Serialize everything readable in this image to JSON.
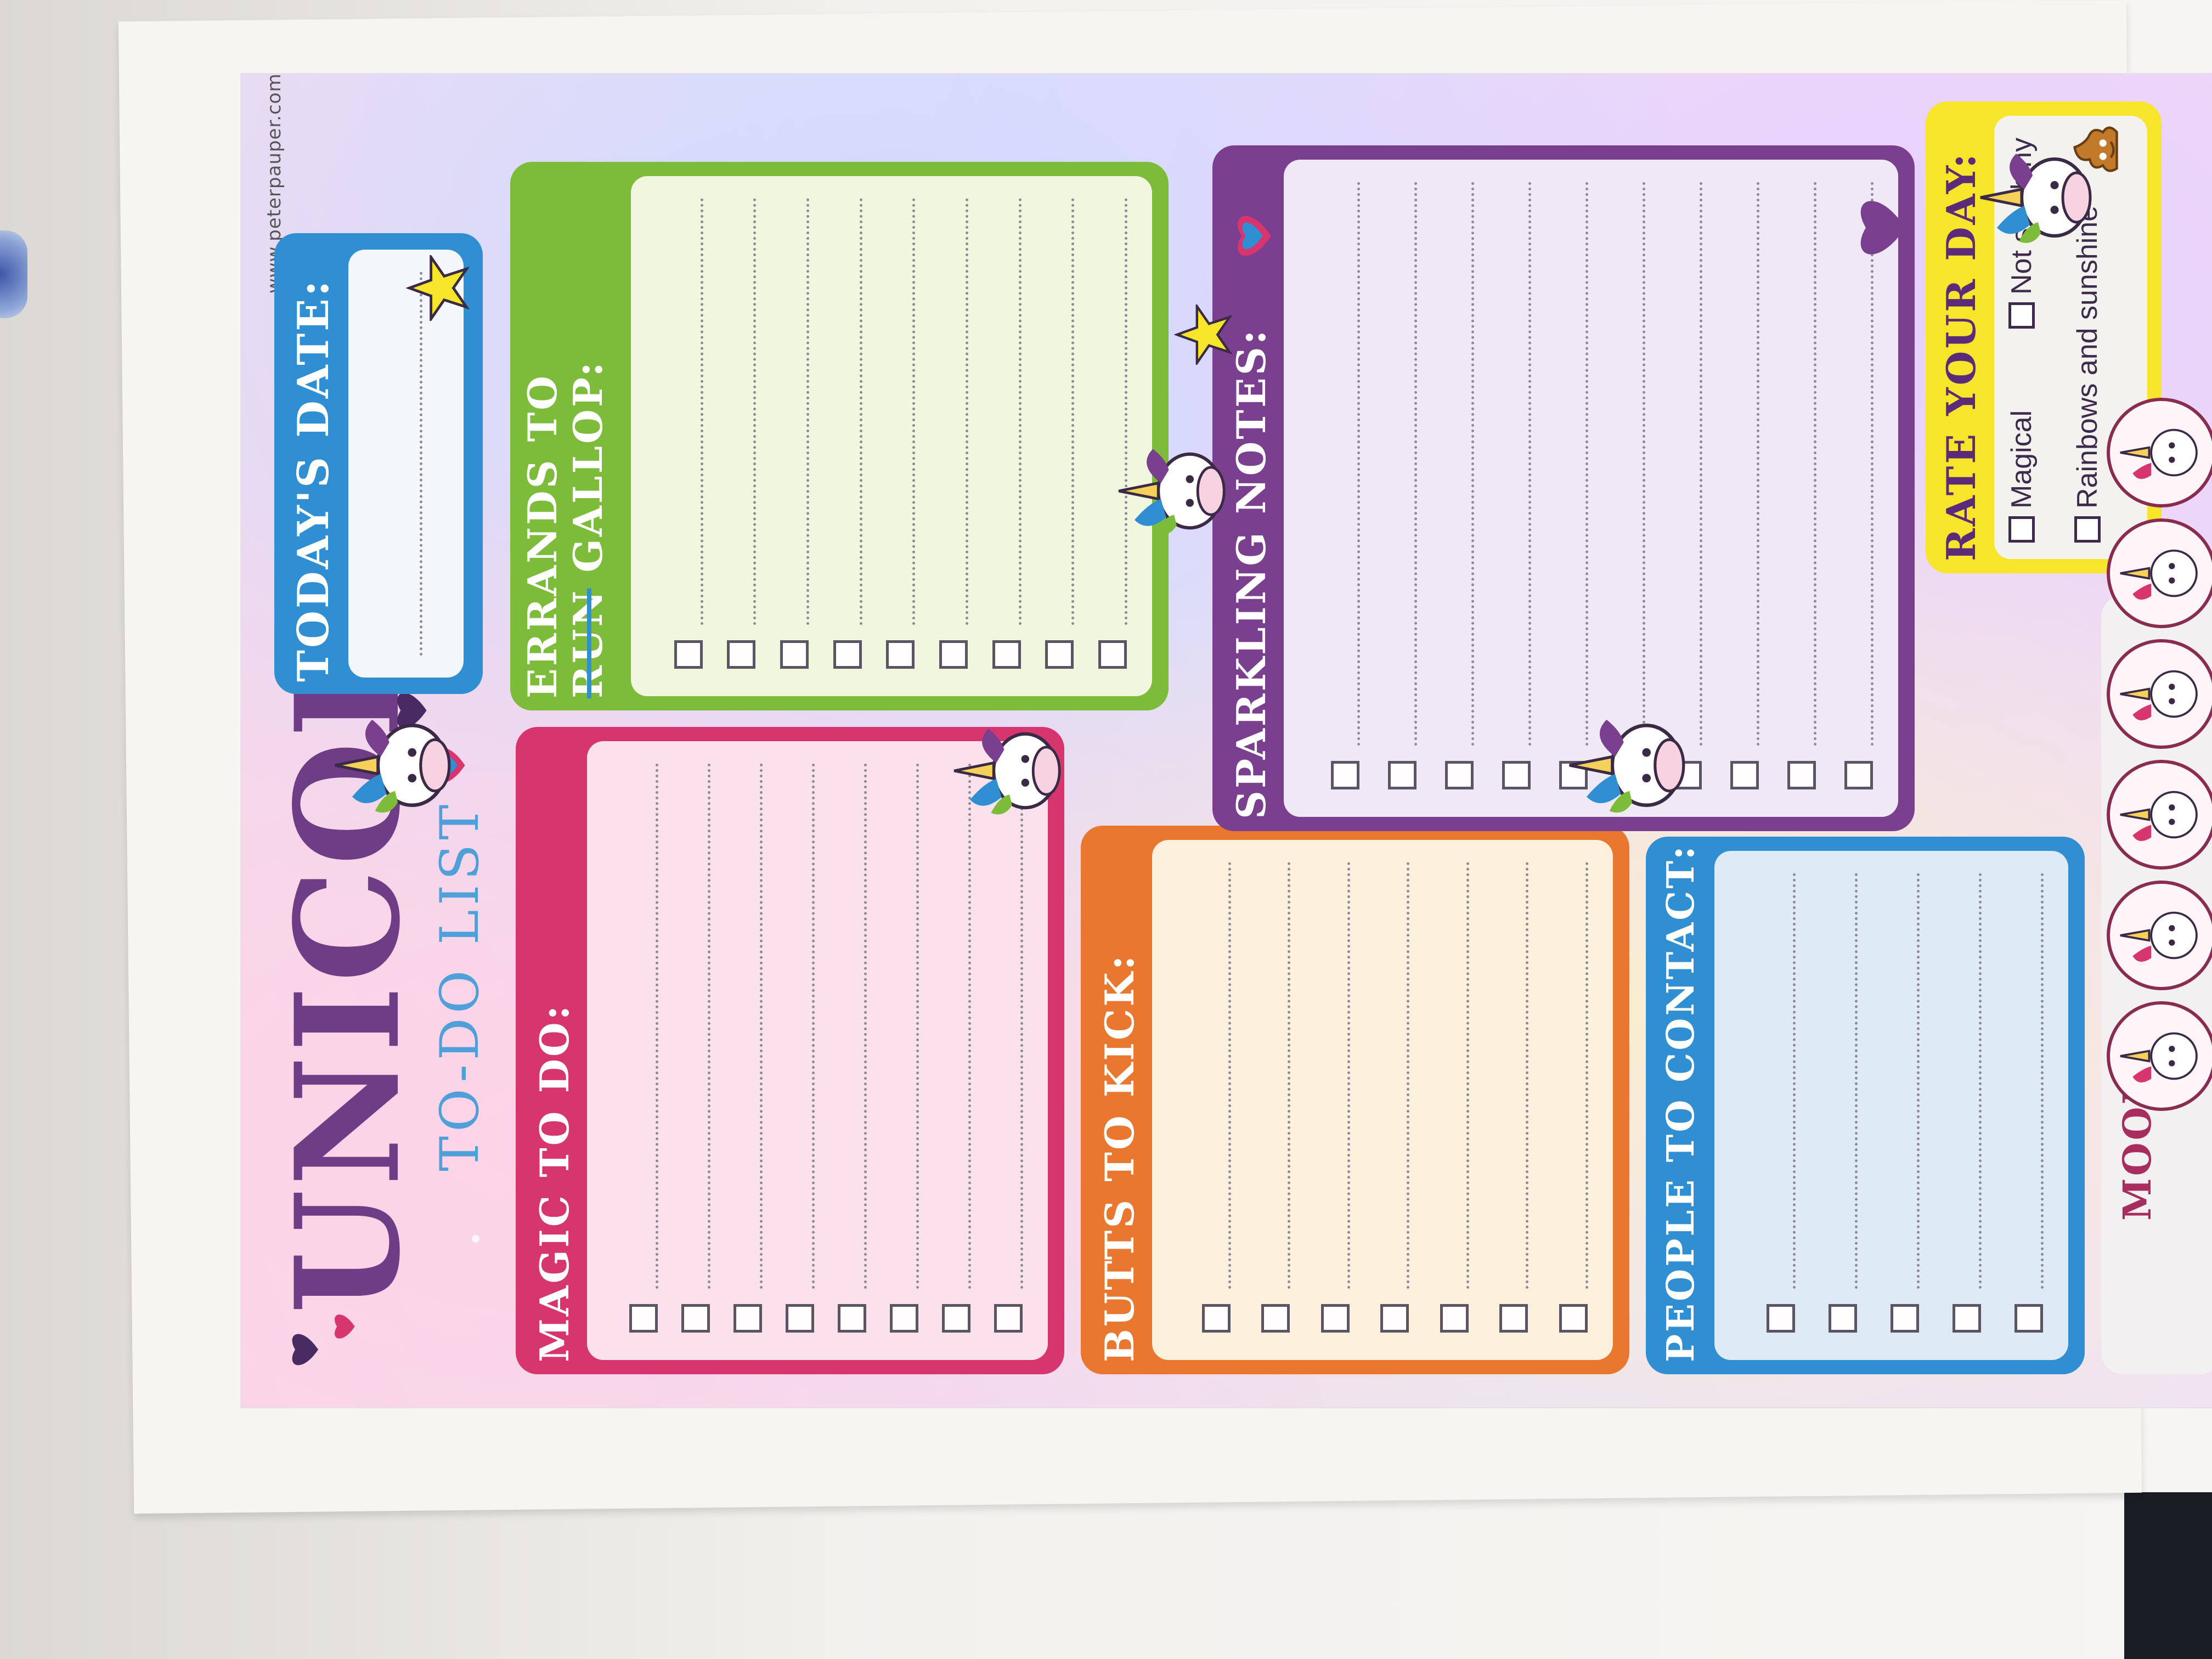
{
  "website": "www.peterpauper.com",
  "title": {
    "main": "UNICORN",
    "sub": "TO-DO LIST"
  },
  "sections": {
    "todays_date": {
      "label": "TODAY'S DATE:"
    },
    "errands": {
      "label_part1": "ERRANDS TO",
      "label_strike": "RUN",
      "label_part2": "GALLOP:"
    },
    "magic_to_do": {
      "label": "MAGIC TO DO:"
    },
    "butts_to_kick": {
      "label": "BUTTS TO KICK:"
    },
    "sparkling_notes": {
      "label": "SPARKLING NOTES:"
    },
    "people_to_contact": {
      "label": "PEOPLE TO CONTACT:"
    },
    "rate_your_day": {
      "label": "RATE YOUR DAY:",
      "options": [
        "Magical",
        "Not so shiny",
        "Rainbows and sunshine"
      ]
    },
    "mood": {
      "label": "MOOD:"
    }
  },
  "colors": {
    "blue": "#2f8fd2",
    "green": "#7cbc3a",
    "pink": "#d7356e",
    "orange": "#e9772f",
    "purple": "#7a3f8e",
    "yellow": "#f6e52a"
  }
}
